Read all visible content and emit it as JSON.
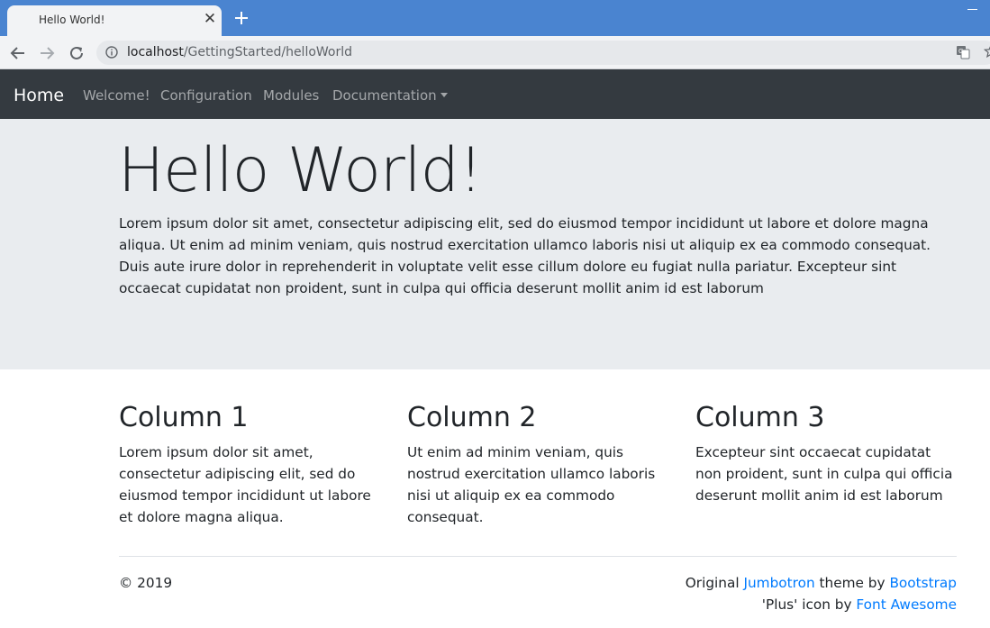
{
  "browser": {
    "tab_title": "Hello World!",
    "tab_close": "✕",
    "url_host": "localhost",
    "url_path": "/GettingStarted/helloWorld",
    "accent_color": "#4a84d0"
  },
  "navbar": {
    "brand": "Home",
    "links": [
      "Welcome!",
      "Configuration",
      "Modules",
      "Documentation"
    ],
    "background": "#343a40"
  },
  "jumbotron": {
    "title": "Hello World!",
    "text": "Lorem ipsum dolor sit amet, consectetur adipiscing elit, sed do eiusmod tempor incididunt ut labore et dolore magna aliqua. Ut enim ad minim veniam, quis nostrud exercitation ullamco laboris nisi ut aliquip ex ea commodo consequat. Duis aute irure dolor in reprehenderit in voluptate velit esse cillum dolore eu fugiat nulla pariatur. Excepteur sint occaecat cupidatat non proident, sunt in culpa qui officia deserunt mollit anim id est laborum",
    "background": "#e9ecef"
  },
  "columns": [
    {
      "title": "Column 1",
      "text": "Lorem ipsum dolor sit amet, consectetur adipiscing elit, sed do eiusmod tempor incididunt ut labore et dolore magna aliqua."
    },
    {
      "title": "Column 2",
      "text": "Ut enim ad minim veniam, quis nostrud exercitation ullamco laboris nisi ut aliquip ex ea commodo consequat."
    },
    {
      "title": "Column 3",
      "text": "Excepteur sint occaecat cupidatat non proident, sunt in culpa qui officia deserunt mollit anim id est laborum"
    }
  ],
  "footer": {
    "copyright": "© 2019",
    "credit1_pre": "Original ",
    "credit1_link1": "Jumbotron",
    "credit1_mid": " theme by ",
    "credit1_link2": "Bootstrap",
    "credit2_pre": "'Plus' icon by ",
    "credit2_link": "Font Awesome",
    "link_color": "#007bff"
  }
}
